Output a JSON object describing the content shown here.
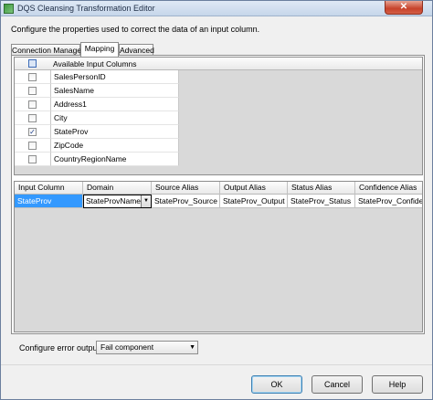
{
  "window": {
    "title": "DQS Cleansing Transformation Editor",
    "close_glyph": "✕"
  },
  "description": "Configure the properties used to correct the data of an input column.",
  "tabs": [
    {
      "label": "Connection Manager",
      "active": false
    },
    {
      "label": "Mapping",
      "active": true
    },
    {
      "label": "Advanced",
      "active": false
    }
  ],
  "available_columns": {
    "header": "Available Input Columns",
    "rows": [
      {
        "name": "SalesPersonID",
        "checked": false
      },
      {
        "name": "SalesName",
        "checked": false
      },
      {
        "name": "Address1",
        "checked": false
      },
      {
        "name": "City",
        "checked": false
      },
      {
        "name": "StateProv",
        "checked": true
      },
      {
        "name": "ZipCode",
        "checked": false
      },
      {
        "name": "CountryRegionName",
        "checked": false
      }
    ]
  },
  "mapping": {
    "columns": [
      "Input Column",
      "Domain",
      "Source Alias",
      "Output Alias",
      "Status Alias",
      "Confidence Alias"
    ],
    "rows": [
      {
        "input_column": "StateProv",
        "domain": "StateProvNames",
        "source_alias": "StateProv_Source",
        "output_alias": "StateProv_Output",
        "status_alias": "StateProv_Status",
        "confidence_alias": "StateProv_Confidence"
      }
    ]
  },
  "error_output": {
    "label": "Configure error output:",
    "value": "Fail component"
  },
  "buttons": {
    "ok": "OK",
    "cancel": "Cancel",
    "help": "Help"
  },
  "colors": {
    "selection": "#3399ff",
    "close_button": "#c7422b"
  }
}
